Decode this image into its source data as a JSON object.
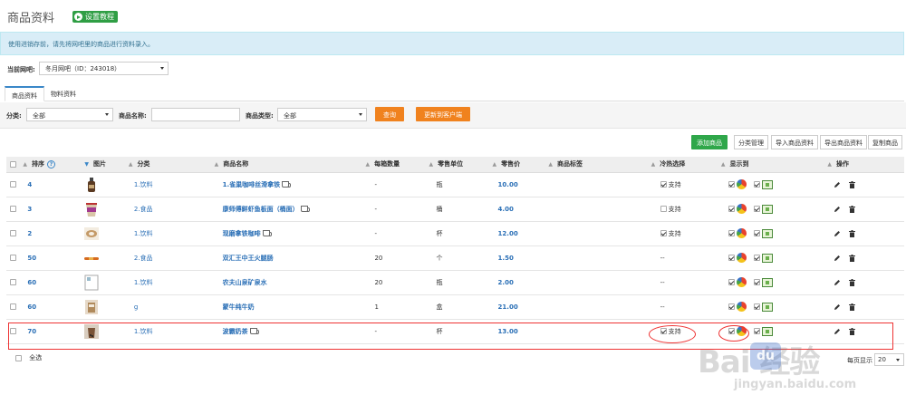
{
  "page": {
    "title": "商品资料",
    "tutorial_label": "设置教程"
  },
  "notice": "使用进销存前，请先将网吧里的商品进行资料录入。",
  "store": {
    "label": "当前网吧:",
    "value": "冬月网吧（ID：243018）"
  },
  "tabs": [
    {
      "label": "商品资料",
      "active": true
    },
    {
      "label": "物料资料",
      "active": false
    }
  ],
  "filters": {
    "category_label": "分类:",
    "category_value": "全部",
    "name_label": "商品名称:",
    "name_value": "",
    "type_label": "商品类型:",
    "type_value": "全部",
    "query_button": "查询",
    "update_button": "更新到客户端"
  },
  "actions": [
    "添加商品",
    "分类管理",
    "导入商品资料",
    "导出商品资料",
    "复制商品"
  ],
  "columns": {
    "sort": "排序",
    "image": "图片",
    "category": "分类",
    "name": "商品名称",
    "per_box": "每箱数量",
    "unit": "零售单位",
    "price": "零售价",
    "tag": "商品标签",
    "hot_cold": "冷热选择",
    "display": "显示到",
    "ops": "操作"
  },
  "rows": [
    {
      "sort": "4",
      "category": "1.饮料",
      "name": "1.雀巢咖啡丝滑拿铁",
      "per_box": "-",
      "unit": "瓶",
      "price": "10.00",
      "hot_cold": "支持",
      "hot_cold_checked": true,
      "has_cup": true,
      "thumb": "bottle"
    },
    {
      "sort": "3",
      "category": "2.食品",
      "name": "康师傅鲜虾鱼板面（桶面）",
      "per_box": "-",
      "unit": "桶",
      "price": "4.00",
      "hot_cold": "支持",
      "hot_cold_checked": false,
      "has_cup": true,
      "thumb": "noodle"
    },
    {
      "sort": "2",
      "category": "1.饮料",
      "name": "现磨拿铁咖啡",
      "per_box": "-",
      "unit": "杯",
      "price": "12.00",
      "hot_cold": "支持",
      "hot_cold_checked": true,
      "has_cup": true,
      "thumb": "latte"
    },
    {
      "sort": "50",
      "category": "2.食品",
      "name": "双汇王中王火腿肠",
      "per_box": "20",
      "unit": "个",
      "price": "1.50",
      "hot_cold": "--",
      "hot_cold_checked": null,
      "has_cup": false,
      "thumb": "sausage"
    },
    {
      "sort": "60",
      "category": "1.饮料",
      "name": "农夫山泉矿泉水",
      "per_box": "20",
      "unit": "瓶",
      "price": "2.00",
      "hot_cold": "--",
      "hot_cold_checked": null,
      "has_cup": false,
      "thumb": "broken"
    },
    {
      "sort": "60",
      "category": "g",
      "name": "蒙牛纯牛奶",
      "per_box": "1",
      "unit": "盒",
      "price": "21.00",
      "hot_cold": "--",
      "hot_cold_checked": null,
      "has_cup": false,
      "thumb": "milk"
    },
    {
      "sort": "70",
      "category": "1.饮料",
      "name": "波霸奶茶",
      "per_box": "-",
      "unit": "杯",
      "price": "13.00",
      "hot_cold": "支持",
      "hot_cold_checked": true,
      "has_cup": true,
      "thumb": "tea"
    }
  ],
  "footer": {
    "select_all": "全选",
    "per_page_label": "每页显示",
    "per_page_value": "20"
  },
  "watermark": {
    "main": "Bai 经验",
    "paw": "du",
    "sub": "jingyan.baidu.com"
  },
  "colors": {
    "accent_blue": "#2a6fb6",
    "orange": "#f0821e",
    "green": "#2fa74a",
    "highlight_red": "#e33333"
  }
}
